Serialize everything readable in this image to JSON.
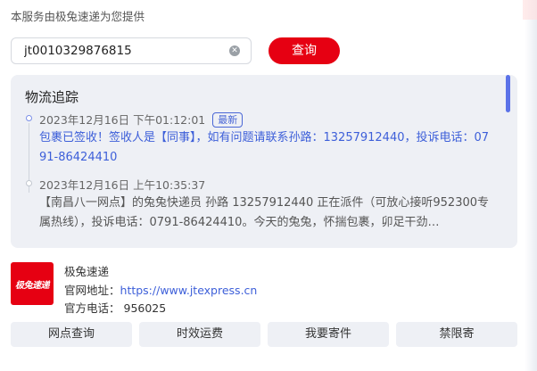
{
  "provider_note": "本服务由极兔速递为您提供",
  "search": {
    "value": "jt0010329876815",
    "button_label": "查询"
  },
  "tracking": {
    "title": "物流追踪",
    "events": [
      {
        "time": "2023年12月16日 下午01:12:01",
        "badge": "最新",
        "desc": "包裹已签收！签收人是【同事】，如有问题请联系孙路：13257912440，投诉电话：0791-86424410"
      },
      {
        "time": "2023年12月16日 上午10:35:37",
        "desc": "【南昌八一网点】的兔兔快递员 孙路 13257912440 正在派件（可放心接听952300专属热线），投诉电话：0791-86424410。今天的兔兔，怀揣包裹，卯足干劲…"
      }
    ]
  },
  "company": {
    "logo_text": "极兔速递",
    "name": "极兔速递",
    "website_label": "官网地址：",
    "website_url": "https://www.jtexpress.cn",
    "phone_label": "官方电话：",
    "phone": "956025"
  },
  "actions": [
    "网点查询",
    "时效运费",
    "我要寄件",
    "禁限寄"
  ],
  "colors": {
    "brand_red": "#e60012",
    "accent_blue": "#3d5fd9",
    "panel_bg": "#eef0f5"
  }
}
